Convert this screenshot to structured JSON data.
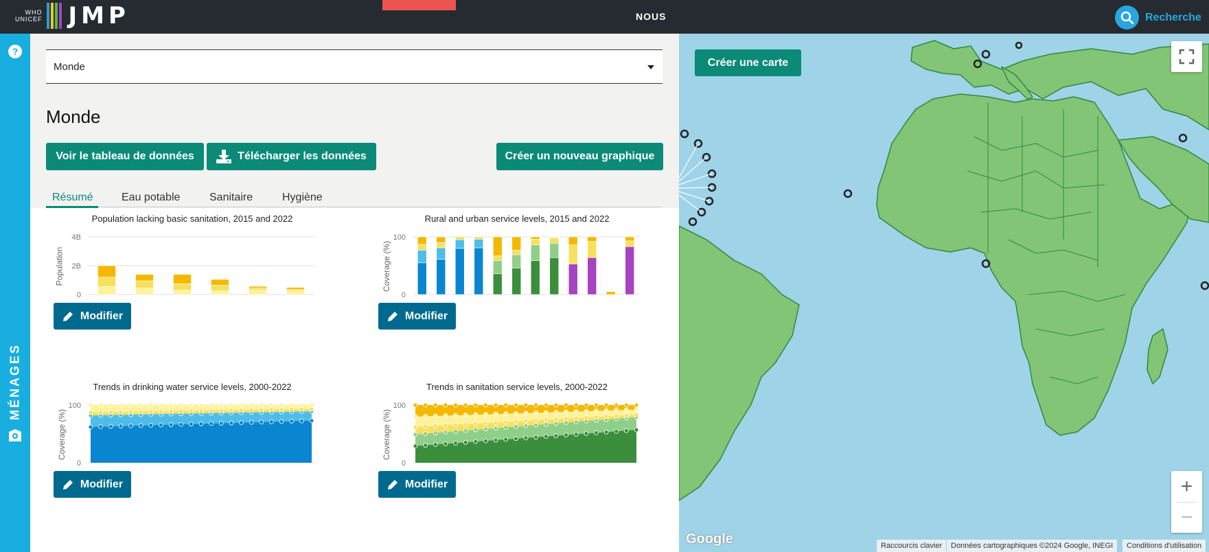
{
  "header": {
    "logo_who": "WHO",
    "logo_unicef": "UNICEF",
    "logo_brand": "JMP",
    "nav_nous": "NOUS",
    "search_label": "Recherche"
  },
  "sidebar": {
    "help": "?",
    "label": "MÉNAGES"
  },
  "panel": {
    "selector_value": "Monde",
    "title": "Monde",
    "buttons": {
      "view_table": "Voir le tableau de données",
      "download": "Télécharger les données",
      "new_chart": "Créer un nouveau graphique"
    },
    "tabs": [
      {
        "label": "Résumé",
        "active": true
      },
      {
        "label": "Eau potable",
        "active": false
      },
      {
        "label": "Sanitaire",
        "active": false
      },
      {
        "label": "Hygiène",
        "active": false
      }
    ],
    "modify_label": "Modifier"
  },
  "colors": {
    "safely_managed_water": "#0a85d0",
    "basic_water": "#4fbde8",
    "limited": "#f6e05e",
    "unimproved": "#fff29a",
    "surface": "#f5b800",
    "safely_managed_san": "#3b8e3c",
    "basic_san": "#8fcf89",
    "hygiene": "#a543c0",
    "teal": "#0b8a78",
    "modify": "#006a8e"
  },
  "chart_data": [
    {
      "type": "bar",
      "title": "Population lacking basic sanitation, 2015 and 2022",
      "ylabel": "Population",
      "yticks": [
        "0",
        "2B",
        "4B"
      ],
      "ylim": [
        0,
        4
      ],
      "categories": [
        "",
        "",
        "",
        "",
        "",
        ""
      ],
      "series": [
        {
          "values": [
            0.55,
            0.45,
            0.3,
            0.25,
            0.3,
            0.25
          ]
        },
        {
          "values": [
            0.65,
            0.5,
            0.45,
            0.4,
            0.15,
            0.12
          ]
        },
        {
          "values": [
            0.8,
            0.45,
            0.65,
            0.4,
            0.12,
            0.12
          ]
        }
      ]
    },
    {
      "type": "bar",
      "title": "Rural and urban service levels, 2015 and 2022",
      "ylabel": "Coverage (%)",
      "yticks": [
        "0",
        "100"
      ],
      "ylim": [
        0,
        100
      ],
      "bars": [
        [
          {
            "c": "safely_managed_water",
            "v": 55
          },
          {
            "c": "basic_water",
            "v": 22
          },
          {
            "c": "limited",
            "v": 10
          },
          {
            "c": "surface",
            "v": 13
          }
        ],
        [
          {
            "c": "safely_managed_water",
            "v": 61
          },
          {
            "c": "basic_water",
            "v": 20
          },
          {
            "c": "limited",
            "v": 9
          },
          {
            "c": "surface",
            "v": 10
          }
        ],
        [
          {
            "c": "safely_managed_water",
            "v": 80
          },
          {
            "c": "basic_water",
            "v": 15
          },
          {
            "c": "limited",
            "v": 5
          }
        ],
        [
          {
            "c": "safely_managed_water",
            "v": 81
          },
          {
            "c": "basic_water",
            "v": 15
          },
          {
            "c": "limited",
            "v": 4
          }
        ],
        [
          {
            "c": "safely_managed_san",
            "v": 36
          },
          {
            "c": "basic_san",
            "v": 23
          },
          {
            "c": "limited",
            "v": 8
          },
          {
            "c": "surface",
            "v": 33
          }
        ],
        [
          {
            "c": "safely_managed_san",
            "v": 46
          },
          {
            "c": "basic_san",
            "v": 23
          },
          {
            "c": "limited",
            "v": 8
          },
          {
            "c": "surface",
            "v": 23
          }
        ],
        [
          {
            "c": "safely_managed_san",
            "v": 59
          },
          {
            "c": "basic_san",
            "v": 27
          },
          {
            "c": "limited",
            "v": 10
          },
          {
            "c": "surface",
            "v": 4
          }
        ],
        [
          {
            "c": "safely_managed_san",
            "v": 64
          },
          {
            "c": "basic_san",
            "v": 25
          },
          {
            "c": "limited",
            "v": 9
          },
          {
            "c": "unimproved",
            "v": 2
          }
        ],
        [
          {
            "c": "hygiene",
            "v": 53
          },
          {
            "c": "limited",
            "v": 33
          },
          {
            "c": "surface",
            "v": 14
          }
        ],
        [
          {
            "c": "hygiene",
            "v": 64
          },
          {
            "c": "limited",
            "v": 28
          },
          {
            "c": "surface",
            "v": 8
          }
        ],
        [
          {
            "c": "surface",
            "v": 5
          }
        ],
        [
          {
            "c": "hygiene",
            "v": 83
          },
          {
            "c": "limited",
            "v": 10
          },
          {
            "c": "surface",
            "v": 7
          }
        ]
      ]
    },
    {
      "type": "area",
      "title": "Trends in drinking water service levels, 2000-2022",
      "ylabel": "Coverage (%)",
      "yticks": [
        "0",
        "100"
      ],
      "ylim": [
        0,
        100
      ],
      "x": [
        2000,
        2022
      ],
      "layers": [
        {
          "c": "safely_managed_water",
          "start": 62,
          "end": 73
        },
        {
          "c": "basic_water",
          "start": 82,
          "end": 89
        },
        {
          "c": "limited",
          "start": 87,
          "end": 93
        },
        {
          "c": "unimproved",
          "start": 100,
          "end": 100
        }
      ]
    },
    {
      "type": "area",
      "title": "Trends in sanitation service levels, 2000-2022",
      "ylabel": "Coverage (%)",
      "yticks": [
        "0",
        "100"
      ],
      "ylim": [
        0,
        100
      ],
      "x": [
        2000,
        2022
      ],
      "layers": [
        {
          "c": "safely_managed_san",
          "start": 29,
          "end": 57
        },
        {
          "c": "basic_san",
          "start": 49,
          "end": 79
        },
        {
          "c": "limited",
          "start": 62,
          "end": 83
        },
        {
          "c": "unimproved",
          "start": 80,
          "end": 92
        },
        {
          "c": "surface",
          "start": 100,
          "end": 100
        }
      ]
    }
  ],
  "map": {
    "create_map": "Créer une carte",
    "zoom_in": "+",
    "zoom_out": "−",
    "google": "Google",
    "attribution_shortcuts": "Raccourcis clavier",
    "attribution_data": "Données cartographiques ©2024 Google, INEGI",
    "attribution_terms": "Conditions d'utilisation"
  }
}
